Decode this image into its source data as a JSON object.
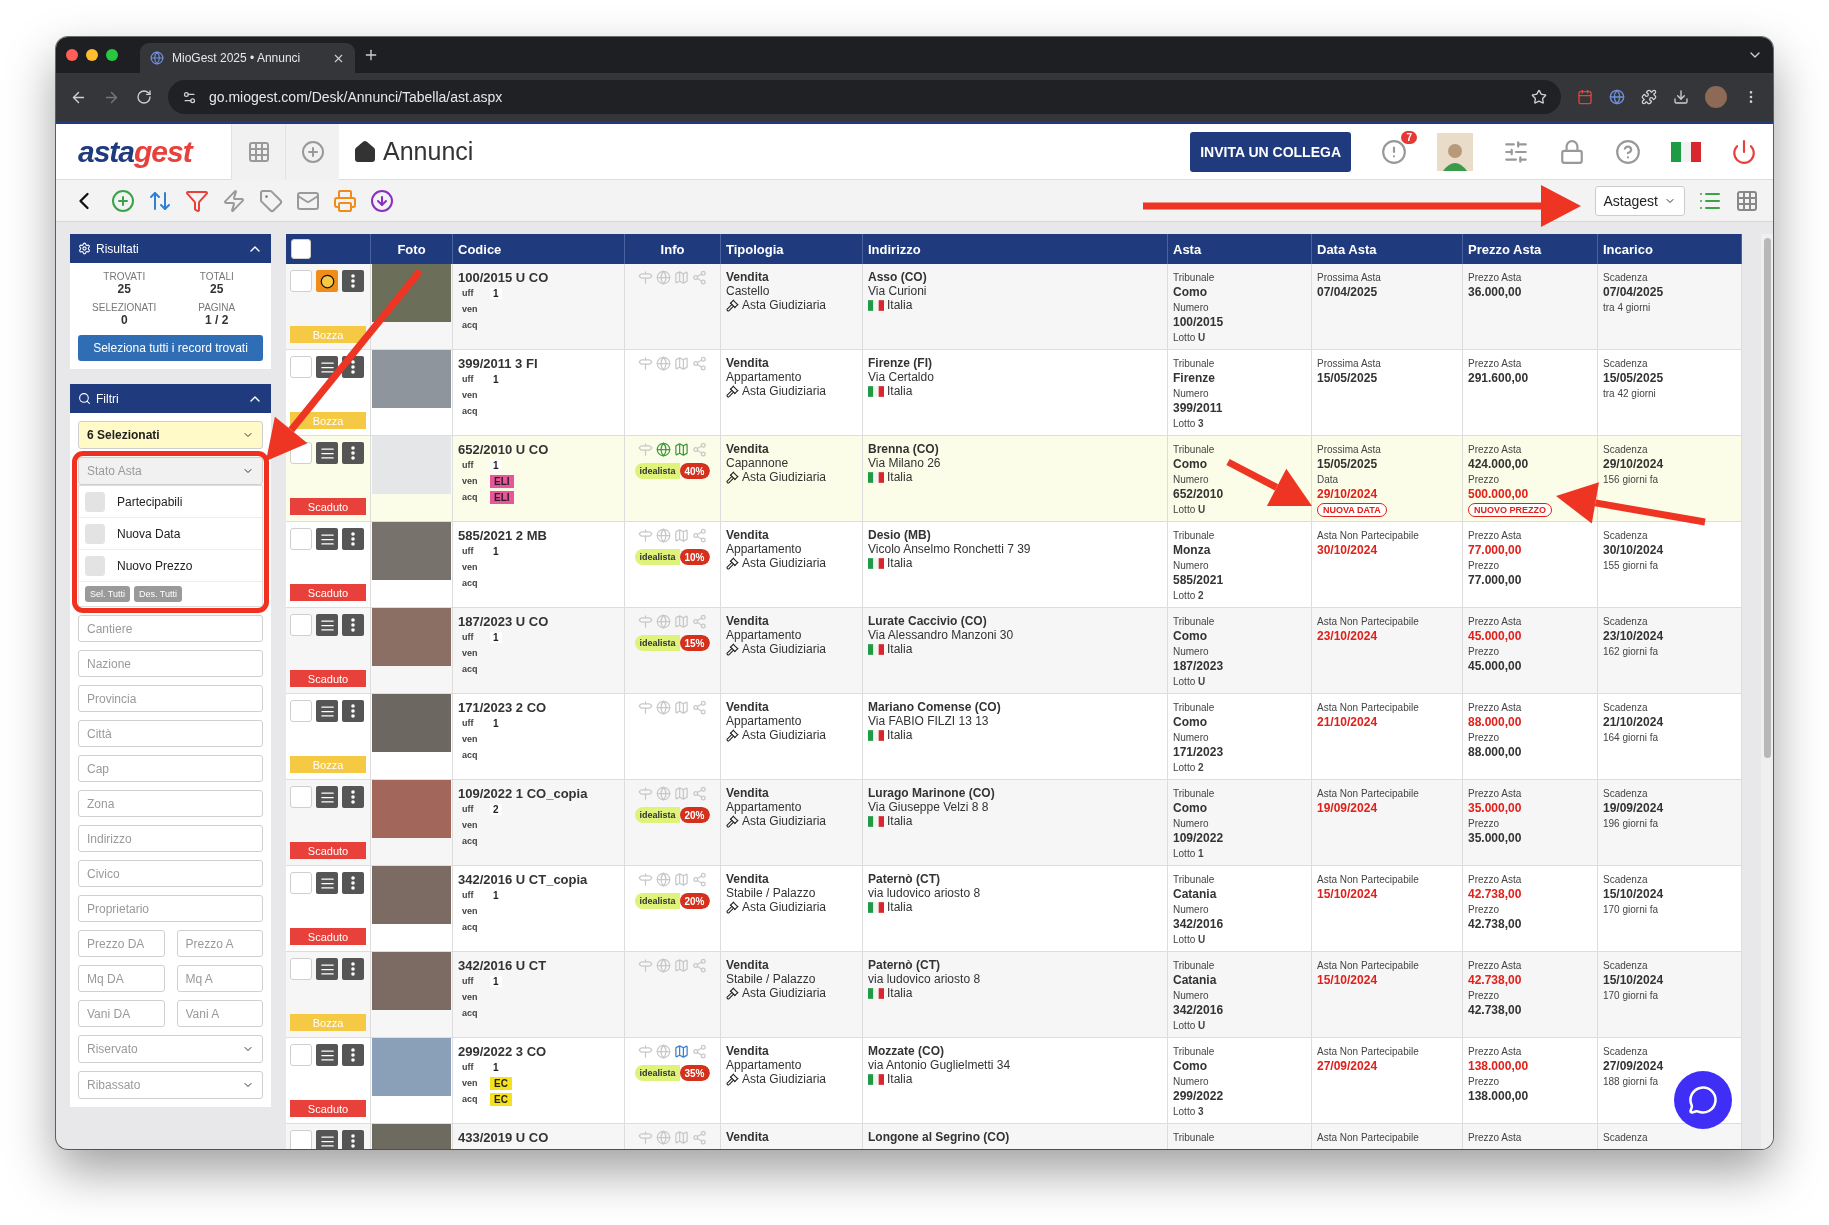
{
  "browser": {
    "tab_title": "MioGest 2025 • Annunci",
    "url": "go.miogest.com/Desk/Annunci/Tabella/ast.aspx"
  },
  "header": {
    "logo": [
      "asta",
      "gest"
    ],
    "page_title": "Annunci",
    "invite_button": "INVITA UN COLLEGA",
    "notification_count": "7"
  },
  "toolbar": {
    "view_select": "Astagest"
  },
  "results": {
    "title": "Risultati",
    "expanded": true,
    "stats": [
      {
        "label": "TROVATI",
        "value": "25"
      },
      {
        "label": "TOTALI",
        "value": "25"
      },
      {
        "label": "SELEZIONATI",
        "value": "0"
      },
      {
        "label": "PAGINA",
        "value": "1 / 2"
      }
    ],
    "select_all_button": "Seleziona tutti i record trovati"
  },
  "filters": {
    "title": "Filtri",
    "expanded": true,
    "selection": "6 Selezionati",
    "status_select": {
      "placeholder": "Stato Asta",
      "expanded": true,
      "options": [
        {
          "label": "Partecipabili",
          "checked": false
        },
        {
          "label": "Nuova Data",
          "checked": false
        },
        {
          "label": "Nuovo Prezzo",
          "checked": false
        }
      ],
      "buttons": [
        "Sel. Tutti",
        "Des. Tutti"
      ]
    },
    "fields": [
      {
        "kind": "input",
        "placeholder": "Cantiere"
      },
      {
        "kind": "input",
        "placeholder": "Nazione"
      },
      {
        "kind": "input",
        "placeholder": "Provincia"
      },
      {
        "kind": "input",
        "placeholder": "Città"
      },
      {
        "kind": "input",
        "placeholder": "Cap"
      },
      {
        "kind": "input",
        "placeholder": "Zona"
      },
      {
        "kind": "input",
        "placeholder": "Indirizzo"
      },
      {
        "kind": "input",
        "placeholder": "Civico"
      },
      {
        "kind": "input",
        "placeholder": "Proprietario"
      },
      {
        "kind": "pair",
        "items": [
          {
            "placeholder": "Prezzo DA"
          },
          {
            "placeholder": "Prezzo A"
          }
        ]
      },
      {
        "kind": "pair",
        "items": [
          {
            "placeholder": "Mq DA"
          },
          {
            "placeholder": "Mq A"
          }
        ]
      },
      {
        "kind": "pair",
        "items": [
          {
            "placeholder": "Vani DA"
          },
          {
            "placeholder": "Vani A"
          }
        ]
      },
      {
        "kind": "select",
        "placeholder": "Riservato"
      },
      {
        "kind": "select",
        "placeholder": "Ribassato"
      }
    ]
  },
  "table": {
    "header_checkbox": {
      "checked": false
    },
    "columns": [
      "Foto",
      "Codice",
      "Info",
      "Tipologia",
      "Indirizzo",
      "Asta",
      "Data Asta",
      "Prezzo Asta",
      "Incarico"
    ],
    "rows": [
      {
        "checked": false,
        "alert": true,
        "highlighted": false,
        "status": {
          "label": "Bozza",
          "kind": "draft"
        },
        "code": "100/2015 U CO",
        "details": [
          {
            "label": "uff",
            "value": "1"
          },
          {
            "label": "ven"
          },
          {
            "label": "acq"
          }
        ],
        "globe_on": false,
        "map": {
          "on": false
        },
        "tipologia": {
          "sale": "Vendita",
          "type": "Castello",
          "procedure": "Asta Giudiziaria"
        },
        "address": {
          "city": "Asso (CO)",
          "street": "Via Curioni",
          "country": "Italia"
        },
        "asta": [
          {
            "kind": "label",
            "text": "Tribunale"
          },
          {
            "kind": "value",
            "text": "Como"
          },
          {
            "kind": "label",
            "text": "Numero"
          },
          {
            "kind": "value",
            "text": "100/2015"
          },
          {
            "kind": "label",
            "text": "Lotto **U**"
          }
        ],
        "data_asta": [
          {
            "kind": "label",
            "text": "Prossima Asta"
          },
          {
            "kind": "value",
            "text": "07/04/2025"
          }
        ],
        "prezzo": [
          {
            "kind": "label",
            "text": "Prezzo Asta"
          },
          {
            "kind": "value",
            "text": "36.000,00"
          }
        ],
        "incarico": [
          {
            "kind": "label",
            "text": "Scadenza"
          },
          {
            "kind": "value",
            "text": "07/04/2025"
          },
          {
            "kind": "label",
            "text": "tra 4 giorni"
          }
        ]
      },
      {
        "checked": false,
        "alert": false,
        "highlighted": false,
        "status": {
          "label": "Bozza",
          "kind": "draft"
        },
        "code": "399/2011 3 FI",
        "details": [
          {
            "label": "uff",
            "value": "1"
          },
          {
            "label": "ven"
          },
          {
            "label": "acq"
          }
        ],
        "globe_on": false,
        "map": {
          "on": false
        },
        "tipologia": {
          "sale": "Vendita",
          "type": "Appartamento",
          "procedure": "Asta Giudiziaria"
        },
        "address": {
          "city": "Firenze (FI)",
          "street": "Via Certaldo",
          "country": "Italia"
        },
        "asta": [
          {
            "kind": "label",
            "text": "Tribunale"
          },
          {
            "kind": "value",
            "text": "Firenze"
          },
          {
            "kind": "label",
            "text": "Numero"
          },
          {
            "kind": "value",
            "text": "399/2011"
          },
          {
            "kind": "label",
            "text": "Lotto **3**"
          }
        ],
        "data_asta": [
          {
            "kind": "label",
            "text": "Prossima Asta"
          },
          {
            "kind": "value",
            "text": "15/05/2025"
          }
        ],
        "prezzo": [
          {
            "kind": "label",
            "text": "Prezzo Asta"
          },
          {
            "kind": "value",
            "text": "291.600,00"
          }
        ],
        "incarico": [
          {
            "kind": "label",
            "text": "Scadenza"
          },
          {
            "kind": "value",
            "text": "15/05/2025"
          },
          {
            "kind": "label",
            "text": "tra 42 giorni"
          }
        ]
      },
      {
        "checked": false,
        "alert": false,
        "highlighted": true,
        "status": {
          "label": "Scaduto",
          "kind": "expired"
        },
        "code": "652/2010 U CO",
        "details": [
          {
            "label": "uff",
            "value": "1"
          },
          {
            "label": "ven",
            "tag": "ELI",
            "color": "#e8559b"
          },
          {
            "label": "acq",
            "tag": "ELI",
            "color": "#e8559b"
          }
        ],
        "globe_on": true,
        "map": {
          "on": true,
          "color": "#3f9b3f"
        },
        "idealista": {
          "label": "idealista",
          "percent": "40%"
        },
        "tipologia": {
          "sale": "Vendita",
          "type": "Capannone",
          "procedure": "Asta Giudiziaria"
        },
        "address": {
          "city": "Brenna (CO)",
          "street": "Via Milano 26",
          "country": "Italia"
        },
        "asta": [
          {
            "kind": "label",
            "text": "Tribunale"
          },
          {
            "kind": "value",
            "text": "Como"
          },
          {
            "kind": "label",
            "text": "Numero"
          },
          {
            "kind": "value",
            "text": "652/2010"
          },
          {
            "kind": "label",
            "text": "Lotto **U**"
          }
        ],
        "data_asta": [
          {
            "kind": "label",
            "text": "Prossima Asta"
          },
          {
            "kind": "value",
            "text": "15/05/2025"
          },
          {
            "kind": "label",
            "text": "Data"
          },
          {
            "kind": "alert",
            "text": "29/10/2024"
          },
          {
            "kind": "tag",
            "text": "NUOVA DATA"
          }
        ],
        "prezzo": [
          {
            "kind": "label",
            "text": "Prezzo Asta"
          },
          {
            "kind": "value",
            "text": "424.000,00"
          },
          {
            "kind": "label",
            "text": "Prezzo"
          },
          {
            "kind": "alert",
            "text": "500.000,00"
          },
          {
            "kind": "tag",
            "text": "NUOVO PREZZO"
          }
        ],
        "incarico": [
          {
            "kind": "label",
            "text": "Scadenza"
          },
          {
            "kind": "value",
            "text": "29/10/2024"
          },
          {
            "kind": "label",
            "text": "156 giorni fa"
          }
        ]
      },
      {
        "checked": false,
        "alert": false,
        "highlighted": false,
        "status": {
          "label": "Scaduto",
          "kind": "expired"
        },
        "code": "585/2021 2 MB",
        "details": [
          {
            "label": "uff",
            "value": "1"
          },
          {
            "label": "ven"
          },
          {
            "label": "acq"
          }
        ],
        "globe_on": false,
        "map": {
          "on": false
        },
        "idealista": {
          "label": "idealista",
          "percent": "10%"
        },
        "tipologia": {
          "sale": "Vendita",
          "type": "Appartamento",
          "procedure": "Asta Giudiziaria"
        },
        "address": {
          "city": "Desio (MB)",
          "street": "Vicolo Anselmo Ronchetti 7 39",
          "country": "Italia"
        },
        "asta": [
          {
            "kind": "label",
            "text": "Tribunale"
          },
          {
            "kind": "value",
            "text": "Monza"
          },
          {
            "kind": "label",
            "text": "Numero"
          },
          {
            "kind": "value",
            "text": "585/2021"
          },
          {
            "kind": "label",
            "text": "Lotto **2**"
          }
        ],
        "data_asta": [
          {
            "kind": "label",
            "text": "Asta Non Partecipabile"
          },
          {
            "kind": "alert",
            "text": "30/10/2024"
          }
        ],
        "prezzo": [
          {
            "kind": "label",
            "text": "Prezzo Asta"
          },
          {
            "kind": "alert",
            "text": "77.000,00"
          },
          {
            "kind": "label",
            "text": "Prezzo"
          },
          {
            "kind": "value",
            "text": "77.000,00"
          }
        ],
        "incarico": [
          {
            "kind": "label",
            "text": "Scadenza"
          },
          {
            "kind": "value",
            "text": "30/10/2024"
          },
          {
            "kind": "label",
            "text": "155 giorni fa"
          }
        ]
      },
      {
        "checked": false,
        "alert": false,
        "highlighted": false,
        "status": {
          "label": "Scaduto",
          "kind": "expired"
        },
        "code": "187/2023 U CO",
        "details": [
          {
            "label": "uff",
            "value": "1"
          },
          {
            "label": "ven"
          },
          {
            "label": "acq"
          }
        ],
        "globe_on": false,
        "map": {
          "on": false
        },
        "idealista": {
          "label": "idealista",
          "percent": "15%"
        },
        "tipologia": {
          "sale": "Vendita",
          "type": "Appartamento",
          "procedure": "Asta Giudiziaria"
        },
        "address": {
          "city": "Lurate Caccivio (CO)",
          "street": "Via Alessandro Manzoni 30",
          "country": "Italia"
        },
        "asta": [
          {
            "kind": "label",
            "text": "Tribunale"
          },
          {
            "kind": "value",
            "text": "Como"
          },
          {
            "kind": "label",
            "text": "Numero"
          },
          {
            "kind": "value",
            "text": "187/2023"
          },
          {
            "kind": "label",
            "text": "Lotto **U**"
          }
        ],
        "data_asta": [
          {
            "kind": "label",
            "text": "Asta Non Partecipabile"
          },
          {
            "kind": "alert",
            "text": "23/10/2024"
          }
        ],
        "prezzo": [
          {
            "kind": "label",
            "text": "Prezzo Asta"
          },
          {
            "kind": "alert",
            "text": "45.000,00"
          },
          {
            "kind": "label",
            "text": "Prezzo"
          },
          {
            "kind": "value",
            "text": "45.000,00"
          }
        ],
        "incarico": [
          {
            "kind": "label",
            "text": "Scadenza"
          },
          {
            "kind": "value",
            "text": "23/10/2024"
          },
          {
            "kind": "label",
            "text": "162 giorni fa"
          }
        ]
      },
      {
        "checked": false,
        "alert": false,
        "highlighted": false,
        "status": {
          "label": "Bozza",
          "kind": "draft"
        },
        "code": "171/2023 2 CO",
        "details": [
          {
            "label": "uff",
            "value": "1"
          },
          {
            "label": "ven"
          },
          {
            "label": "acq"
          }
        ],
        "globe_on": false,
        "map": {
          "on": false
        },
        "tipologia": {
          "sale": "Vendita",
          "type": "Appartamento",
          "procedure": "Asta Giudiziaria"
        },
        "address": {
          "city": "Mariano Comense (CO)",
          "street": "Via FABIO FILZI 13 13",
          "country": "Italia"
        },
        "asta": [
          {
            "kind": "label",
            "text": "Tribunale"
          },
          {
            "kind": "value",
            "text": "Como"
          },
          {
            "kind": "label",
            "text": "Numero"
          },
          {
            "kind": "value",
            "text": "171/2023"
          },
          {
            "kind": "label",
            "text": "Lotto **2**"
          }
        ],
        "data_asta": [
          {
            "kind": "label",
            "text": "Asta Non Partecipabile"
          },
          {
            "kind": "alert",
            "text": "21/10/2024"
          }
        ],
        "prezzo": [
          {
            "kind": "label",
            "text": "Prezzo Asta"
          },
          {
            "kind": "alert",
            "text": "88.000,00"
          },
          {
            "kind": "label",
            "text": "Prezzo"
          },
          {
            "kind": "value",
            "text": "88.000,00"
          }
        ],
        "incarico": [
          {
            "kind": "label",
            "text": "Scadenza"
          },
          {
            "kind": "value",
            "text": "21/10/2024"
          },
          {
            "kind": "label",
            "text": "164 giorni fa"
          }
        ]
      },
      {
        "checked": false,
        "alert": false,
        "highlighted": false,
        "status": {
          "label": "Scaduto",
          "kind": "expired"
        },
        "code": "109/2022 1 CO_copia",
        "details": [
          {
            "label": "uff",
            "value": "2"
          },
          {
            "label": "ven"
          },
          {
            "label": "acq"
          }
        ],
        "globe_on": false,
        "map": {
          "on": false
        },
        "idealista": {
          "label": "idealista",
          "percent": "20%"
        },
        "tipologia": {
          "sale": "Vendita",
          "type": "Appartamento",
          "procedure": "Asta Giudiziaria"
        },
        "address": {
          "city": "Lurago Marinone (CO)",
          "street": "Via Giuseppe Velzi 8 8",
          "country": "Italia"
        },
        "asta": [
          {
            "kind": "label",
            "text": "Tribunale"
          },
          {
            "kind": "value",
            "text": "Como"
          },
          {
            "kind": "label",
            "text": "Numero"
          },
          {
            "kind": "value",
            "text": "109/2022"
          },
          {
            "kind": "label",
            "text": "Lotto **1**"
          }
        ],
        "data_asta": [
          {
            "kind": "label",
            "text": "Asta Non Partecipabile"
          },
          {
            "kind": "alert",
            "text": "19/09/2024"
          }
        ],
        "prezzo": [
          {
            "kind": "label",
            "text": "Prezzo Asta"
          },
          {
            "kind": "alert",
            "text": "35.000,00"
          },
          {
            "kind": "label",
            "text": "Prezzo"
          },
          {
            "kind": "value",
            "text": "35.000,00"
          }
        ],
        "incarico": [
          {
            "kind": "label",
            "text": "Scadenza"
          },
          {
            "kind": "value",
            "text": "19/09/2024"
          },
          {
            "kind": "label",
            "text": "196 giorni fa"
          }
        ]
      },
      {
        "checked": false,
        "alert": false,
        "highlighted": false,
        "status": {
          "label": "Scaduto",
          "kind": "expired"
        },
        "code": "342/2016 U CT_copia",
        "details": [
          {
            "label": "uff",
            "value": "1"
          },
          {
            "label": "ven"
          },
          {
            "label": "acq"
          }
        ],
        "globe_on": false,
        "map": {
          "on": false
        },
        "idealista": {
          "label": "idealista",
          "percent": "20%"
        },
        "tipologia": {
          "sale": "Vendita",
          "type": "Stabile / Palazzo",
          "procedure": "Asta Giudiziaria"
        },
        "address": {
          "city": "Paternò (CT)",
          "street": "via ludovico ariosto 8",
          "country": "Italia"
        },
        "asta": [
          {
            "kind": "label",
            "text": "Tribunale"
          },
          {
            "kind": "value",
            "text": "Catania"
          },
          {
            "kind": "label",
            "text": "Numero"
          },
          {
            "kind": "value",
            "text": "342/2016"
          },
          {
            "kind": "label",
            "text": "Lotto **U**"
          }
        ],
        "data_asta": [
          {
            "kind": "label",
            "text": "Asta Non Partecipabile"
          },
          {
            "kind": "alert",
            "text": "15/10/2024"
          }
        ],
        "prezzo": [
          {
            "kind": "label",
            "text": "Prezzo Asta"
          },
          {
            "kind": "alert",
            "text": "42.738,00"
          },
          {
            "kind": "label",
            "text": "Prezzo"
          },
          {
            "kind": "value",
            "text": "42.738,00"
          }
        ],
        "incarico": [
          {
            "kind": "label",
            "text": "Scadenza"
          },
          {
            "kind": "value",
            "text": "15/10/2024"
          },
          {
            "kind": "label",
            "text": "170 giorni fa"
          }
        ]
      },
      {
        "checked": false,
        "alert": false,
        "highlighted": false,
        "status": {
          "label": "Bozza",
          "kind": "draft"
        },
        "code": "342/2016 U CT",
        "details": [
          {
            "label": "uff",
            "value": "1"
          },
          {
            "label": "ven"
          },
          {
            "label": "acq"
          }
        ],
        "globe_on": false,
        "map": {
          "on": false
        },
        "tipologia": {
          "sale": "Vendita",
          "type": "Stabile / Palazzo",
          "procedure": "Asta Giudiziaria"
        },
        "address": {
          "city": "Paternò (CT)",
          "street": "via ludovico ariosto 8",
          "country": "Italia"
        },
        "asta": [
          {
            "kind": "label",
            "text": "Tribunale"
          },
          {
            "kind": "value",
            "text": "Catania"
          },
          {
            "kind": "label",
            "text": "Numero"
          },
          {
            "kind": "value",
            "text": "342/2016"
          },
          {
            "kind": "label",
            "text": "Lotto **U**"
          }
        ],
        "data_asta": [
          {
            "kind": "label",
            "text": "Asta Non Partecipabile"
          },
          {
            "kind": "alert",
            "text": "15/10/2024"
          }
        ],
        "prezzo": [
          {
            "kind": "label",
            "text": "Prezzo Asta"
          },
          {
            "kind": "alert",
            "text": "42.738,00"
          },
          {
            "kind": "label",
            "text": "Prezzo"
          },
          {
            "kind": "value",
            "text": "42.738,00"
          }
        ],
        "incarico": [
          {
            "kind": "label",
            "text": "Scadenza"
          },
          {
            "kind": "value",
            "text": "15/10/2024"
          },
          {
            "kind": "label",
            "text": "170 giorni fa"
          }
        ]
      },
      {
        "checked": false,
        "alert": false,
        "highlighted": false,
        "status": {
          "label": "Scaduto",
          "kind": "expired"
        },
        "code": "299/2022 3 CO",
        "details": [
          {
            "label": "uff",
            "value": "1"
          },
          {
            "label": "ven",
            "tag": "EC",
            "color": "#f5e11c"
          },
          {
            "label": "acq",
            "tag": "EC",
            "color": "#f5e11c"
          }
        ],
        "globe_on": false,
        "map": {
          "on": true,
          "color": "#3a7fd6"
        },
        "idealista": {
          "label": "idealista",
          "percent": "35%"
        },
        "tipologia": {
          "sale": "Vendita",
          "type": "Appartamento",
          "procedure": "Asta Giudiziaria"
        },
        "address": {
          "city": "Mozzate (CO)",
          "street": "via Antonio Guglielmetti 34",
          "country": "Italia"
        },
        "asta": [
          {
            "kind": "label",
            "text": "Tribunale"
          },
          {
            "kind": "value",
            "text": "Como"
          },
          {
            "kind": "label",
            "text": "Numero"
          },
          {
            "kind": "value",
            "text": "299/2022"
          },
          {
            "kind": "label",
            "text": "Lotto **3**"
          }
        ],
        "data_asta": [
          {
            "kind": "label",
            "text": "Asta Non Partecipabile"
          },
          {
            "kind": "alert",
            "text": "27/09/2024"
          }
        ],
        "prezzo": [
          {
            "kind": "label",
            "text": "Prezzo Asta"
          },
          {
            "kind": "alert",
            "text": "138.000,00"
          },
          {
            "kind": "label",
            "text": "Prezzo"
          },
          {
            "kind": "value",
            "text": "138.000,00"
          }
        ],
        "incarico": [
          {
            "kind": "label",
            "text": "Scadenza"
          },
          {
            "kind": "value",
            "text": "27/09/2024"
          },
          {
            "kind": "label",
            "text": "188 giorni fa"
          }
        ]
      },
      {
        "checked": false,
        "alert": false,
        "highlighted": false,
        "code": "433/2019 U CO",
        "details": [],
        "globe_on": false,
        "map": {
          "on": false
        },
        "tipologia": {
          "sale": "Vendita"
        },
        "address": {
          "city": "Longone al Segrino (CO)"
        },
        "asta": [
          {
            "kind": "label",
            "text": "Tribunale"
          }
        ],
        "data_asta": [
          {
            "kind": "label",
            "text": "Asta Non Partecipabile"
          }
        ],
        "prezzo": [
          {
            "kind": "label",
            "text": "Prezzo Asta"
          }
        ],
        "incarico": [
          {
            "kind": "label",
            "text": "Scadenza"
          }
        ]
      }
    ]
  }
}
